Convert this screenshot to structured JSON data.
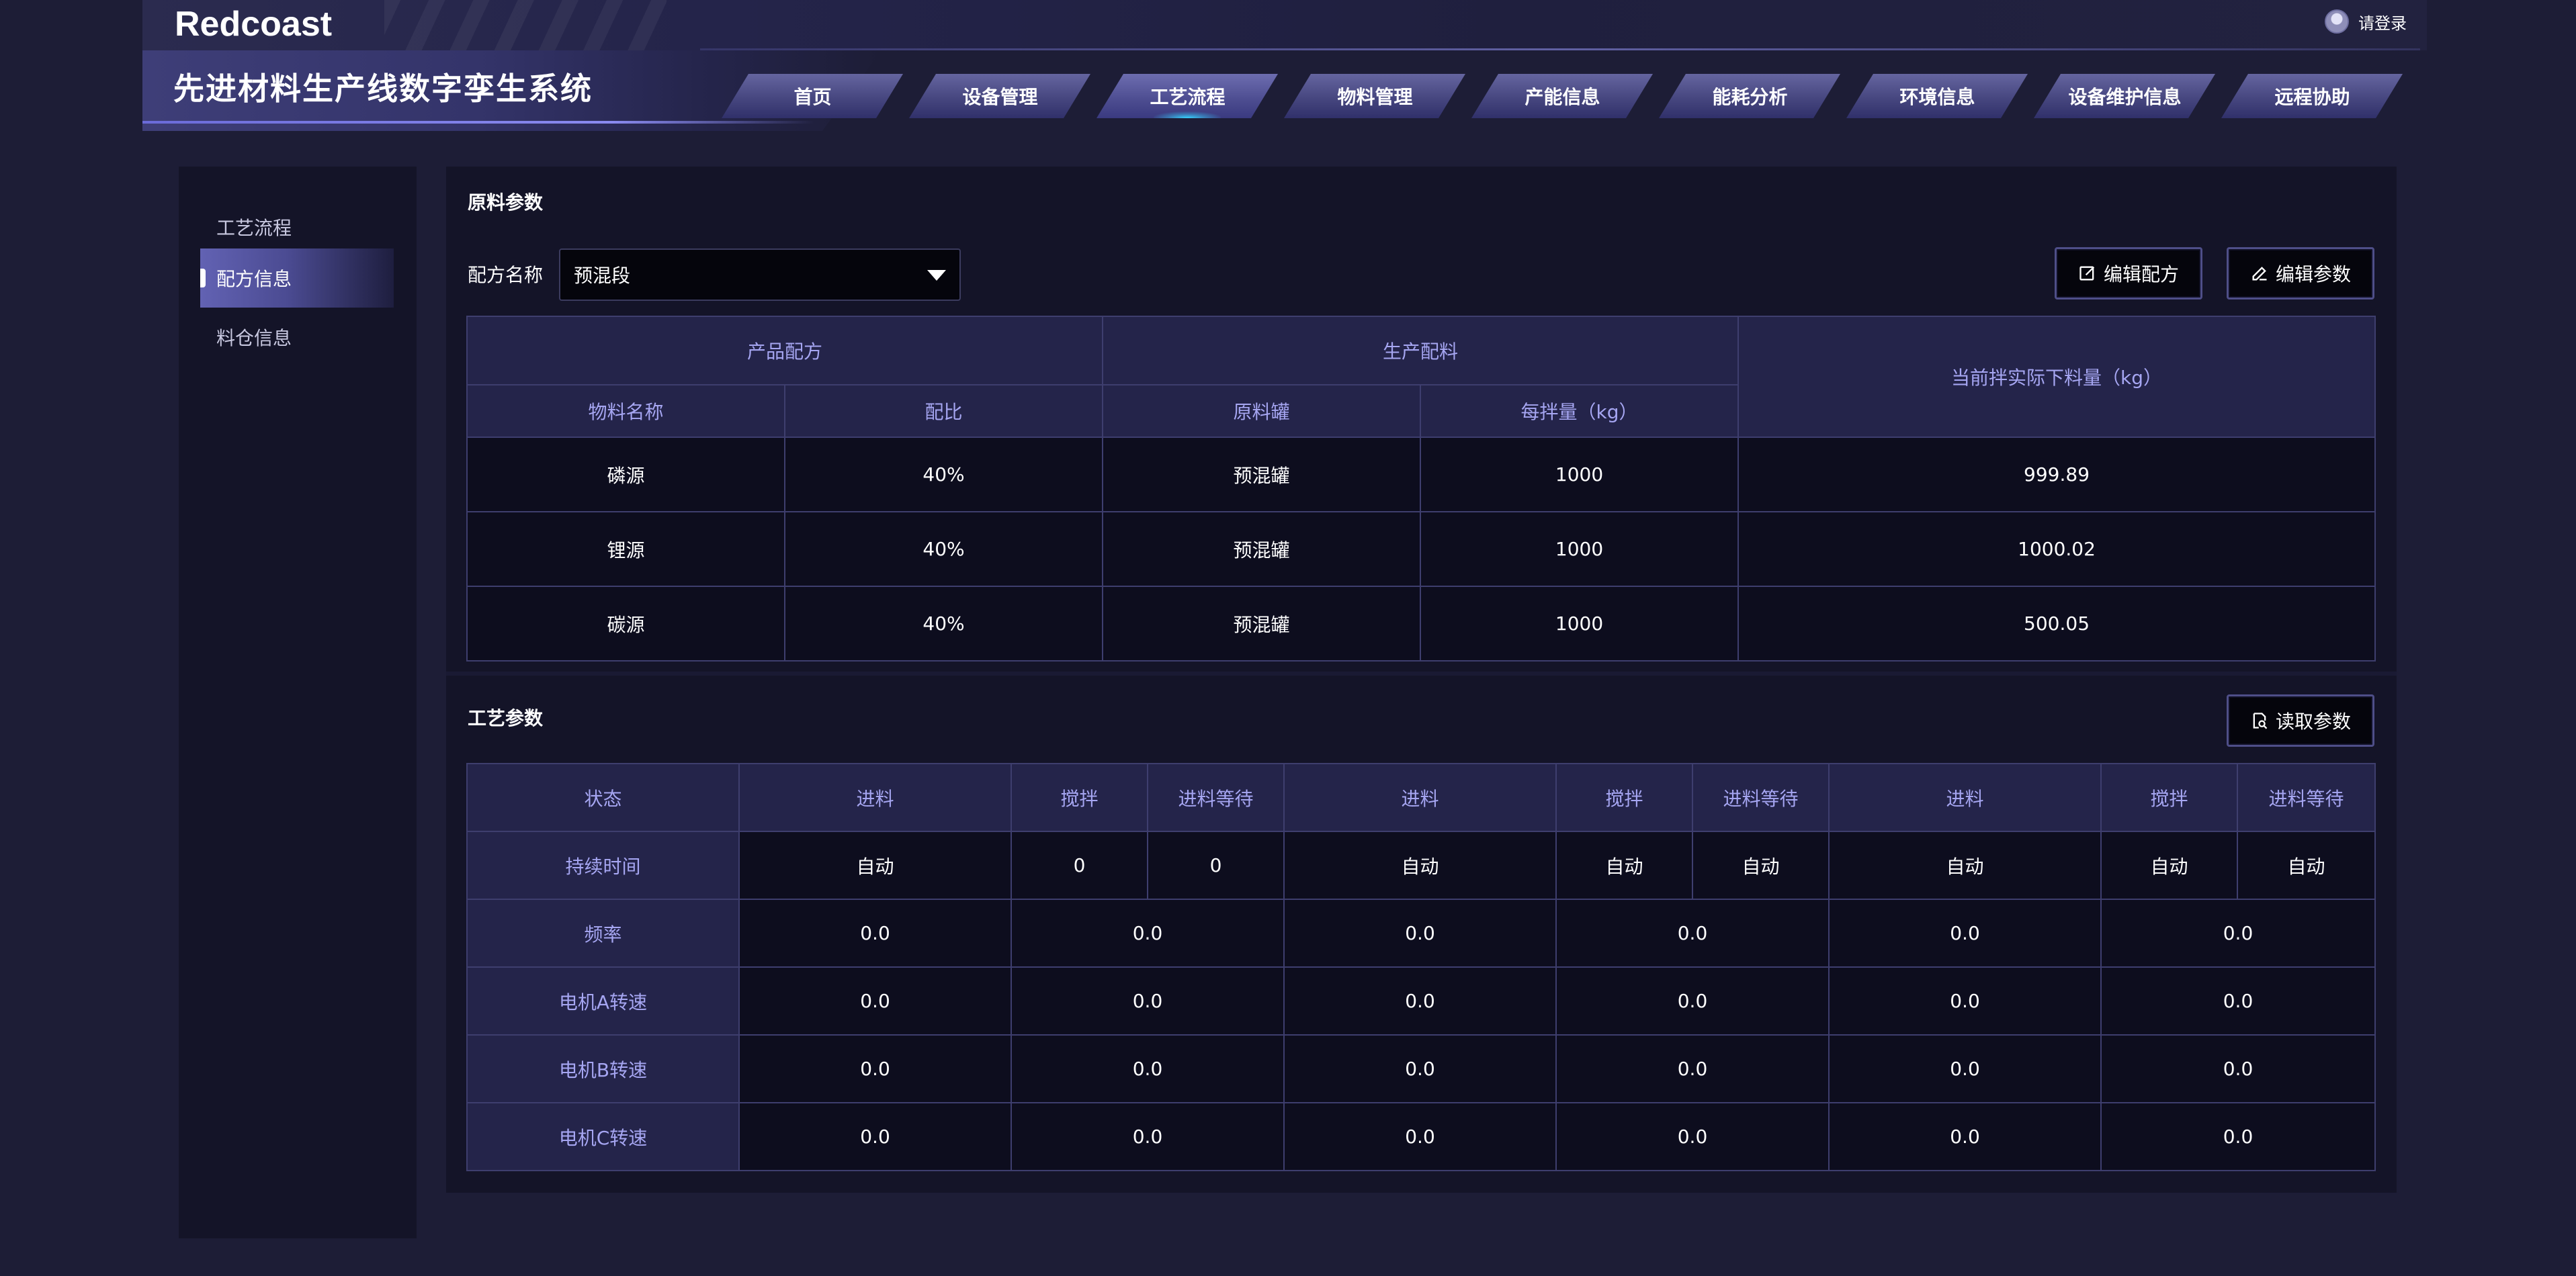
{
  "header": {
    "logo": "Redcoast",
    "system_title": "先进材料生产线数字孪生系统",
    "login_label": "请登录",
    "tabs": [
      {
        "label": "首页"
      },
      {
        "label": "设备管理"
      },
      {
        "label": "工艺流程"
      },
      {
        "label": "物料管理"
      },
      {
        "label": "产能信息"
      },
      {
        "label": "能耗分析"
      },
      {
        "label": "环境信息"
      },
      {
        "label": "设备维护信息"
      },
      {
        "label": "远程协助"
      }
    ],
    "active_tab": "工艺流程"
  },
  "sidebar": {
    "items": [
      {
        "label": "工艺流程"
      },
      {
        "label": "配方信息"
      },
      {
        "label": "料仓信息"
      }
    ],
    "active_item": "配方信息"
  },
  "raw_params": {
    "title": "原料参数",
    "recipe_label": "配方名称",
    "recipe_value": "预混段",
    "edit_recipe_button": "编辑配方",
    "edit_params_button": "编辑参数",
    "group_headers": {
      "product_recipe": "产品配方",
      "production_batching": "生产配料",
      "actual_feed": "当前拌实际下料量（kg）"
    },
    "columns": {
      "material_name": "物料名称",
      "ratio": "配比",
      "tank": "原料罐",
      "per_batch": "每拌量（kg）"
    },
    "rows": [
      {
        "material": "磷源",
        "ratio": "40%",
        "tank": "预混罐",
        "per_batch": "1000",
        "actual": "999.89"
      },
      {
        "material": "锂源",
        "ratio": "40%",
        "tank": "预混罐",
        "per_batch": "1000",
        "actual": "1000.02"
      },
      {
        "material": "碳源",
        "ratio": "40%",
        "tank": "预混罐",
        "per_batch": "1000",
        "actual": "500.05"
      }
    ]
  },
  "process_params": {
    "title": "工艺参数",
    "read_button": "读取参数",
    "header_row": {
      "label": "状态",
      "cells": [
        "进料",
        "搅拌",
        "进料等待",
        "进料",
        "搅拌",
        "进料等待",
        "进料",
        "搅拌",
        "进料等待"
      ]
    },
    "duration_row": {
      "label": "持续时间",
      "cells": [
        "自动",
        "0",
        "0",
        "自动",
        "自动",
        "自动",
        "自动",
        "自动",
        "自动"
      ]
    },
    "rows": [
      {
        "label": "频率",
        "values": [
          "0.0",
          "0.0",
          "0.0",
          "0.0",
          "0.0",
          "0.0"
        ]
      },
      {
        "label": "电机A转速",
        "values": [
          "0.0",
          "0.0",
          "0.0",
          "0.0",
          "0.0",
          "0.0"
        ]
      },
      {
        "label": "电机B转速",
        "values": [
          "0.0",
          "0.0",
          "0.0",
          "0.0",
          "0.0",
          "0.0"
        ]
      },
      {
        "label": "电机C转速",
        "values": [
          "0.0",
          "0.0",
          "0.0",
          "0.0",
          "0.0",
          "0.0"
        ]
      }
    ]
  },
  "colors": {
    "background": "#1d1d36",
    "panel": "#141428",
    "header_cell": "#24244a",
    "header_text": "#a6a6f2",
    "body_cell": "#0d0d1e",
    "accent_glow": "#37d3ff"
  }
}
